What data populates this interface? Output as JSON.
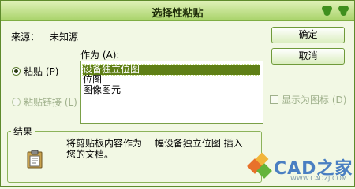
{
  "dialog": {
    "title": "选择性粘贴",
    "source_label": "来源：",
    "source_value": "未知源",
    "as_label": "作为 (A):",
    "list_items": [
      "设备独立位图",
      "位图",
      "图像图元"
    ],
    "buttons": {
      "ok": "确定",
      "cancel": "取消"
    },
    "paste_radio": "粘贴 (P)",
    "paste_link_radio": "粘贴链接 (L)",
    "display_as_icon": "显示为图标 (D)",
    "result_label": "结果",
    "result_text": "将剪贴板内容作为 一幅设备独立位图 插入您的文档。"
  },
  "watermark": {
    "text": "CAD之家",
    "url": "WWW.CADZJ.COM"
  },
  "colors": {
    "titlebar": "#a9d36a",
    "background": "#f2f8e4",
    "selection": "#5f7f16"
  }
}
